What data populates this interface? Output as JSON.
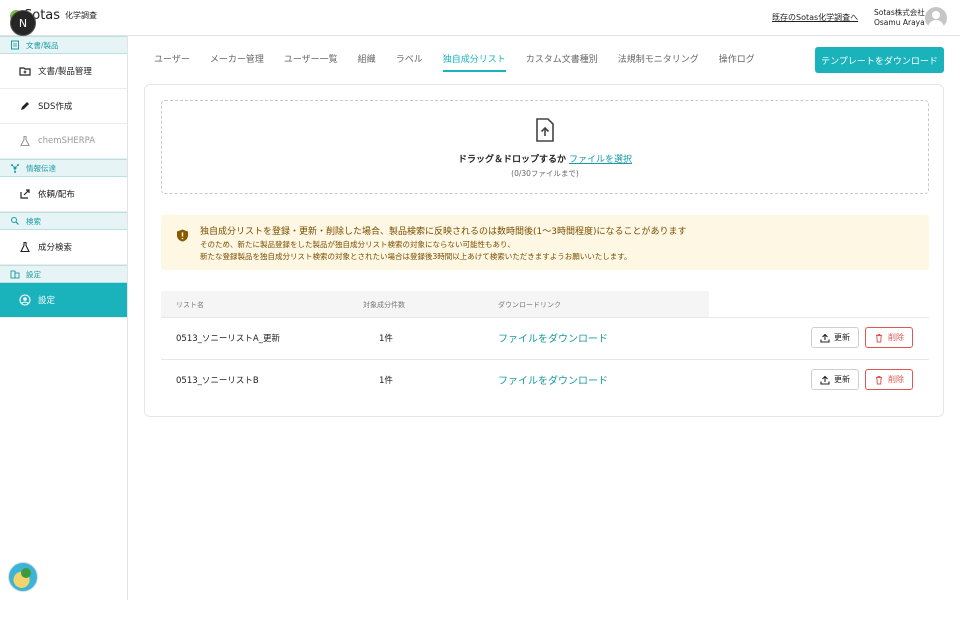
{
  "header": {
    "logo_text": "Sotas",
    "logo_sub": "化学調査",
    "badge": "N",
    "legacy_link": "既存のSotas化学調査へ",
    "company": "Sotas株式会社",
    "user_name": "Osamu Araya"
  },
  "sidebar": {
    "sections": [
      {
        "title": "文書/製品",
        "items": [
          {
            "label": "文書/製品管理"
          },
          {
            "label": "SDS作成"
          },
          {
            "label": "chemSHERPA"
          }
        ]
      },
      {
        "title": "情報伝達",
        "items": [
          {
            "label": "依頼/配布"
          }
        ]
      },
      {
        "title": "検索",
        "items": [
          {
            "label": "成分検索"
          }
        ]
      },
      {
        "title": "設定",
        "items": [
          {
            "label": "設定"
          }
        ]
      }
    ]
  },
  "tabs": [
    "ユーザー",
    "メーカー管理",
    "ユーザー一覧",
    "組織",
    "ラベル",
    "独自成分リスト",
    "カスタム文書種別",
    "法規制モニタリング",
    "操作ログ"
  ],
  "active_tab": "独自成分リスト",
  "template_button": "テンプレートをダウンロード",
  "dropzone": {
    "text": "ドラッグ＆ドロップするか",
    "link": "ファイルを選択",
    "sub": "(0/30ファイルまで)"
  },
  "notice": {
    "title": "独自成分リストを登録・更新・削除した場合、製品検索に反映されるのは数時間後(1〜3時間程度)になることがあります",
    "line1": "そのため、新たに製品登録をした製品が独自成分リスト検索の対象にならない可能性もあり、",
    "line2": "新たな登録製品を独自成分リスト検索の対象とされたい場合は登録後3時間以上あけて検索いただきますようお願いいたします。"
  },
  "table": {
    "headers": [
      "リスト名",
      "対象成分件数",
      "ダウンロードリンク"
    ],
    "rows": [
      {
        "name": "0513_ソニーリストA_更新",
        "count": "1件",
        "link": "ファイルをダウンロード"
      },
      {
        "name": "0513_ソニーリストB",
        "count": "1件",
        "link": "ファイルをダウンロード"
      }
    ],
    "update_label": "更新",
    "delete_label": "削除"
  },
  "colors": {
    "accent": "#1ab3bc",
    "danger": "#e05555",
    "notice_bg": "#fdf7e3",
    "notice_text": "#7a4d00"
  }
}
